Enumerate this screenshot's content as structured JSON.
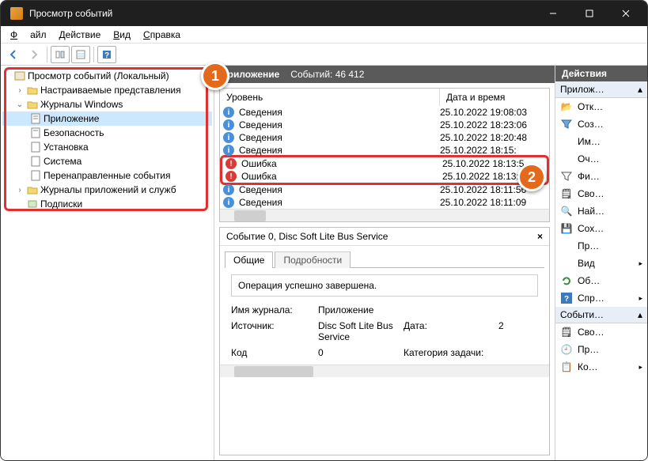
{
  "window": {
    "title": "Просмотр событий"
  },
  "menu": {
    "file": "Файл",
    "action": "Действие",
    "view": "Вид",
    "help": "Справка"
  },
  "tree": {
    "root": "Просмотр событий (Локальный)",
    "custom_views": "Настраиваемые представления",
    "win_logs": "Журналы Windows",
    "app": "Приложение",
    "security": "Безопасность",
    "setup": "Установка",
    "system": "Система",
    "forwarded": "Перенаправленные события",
    "apps_services": "Журналы приложений и служб",
    "subscriptions": "Подписки"
  },
  "center": {
    "name": "Приложение",
    "count_label": "Событий: 46 412",
    "col_level": "Уровень",
    "col_date": "Дата и время",
    "rows": [
      {
        "type": "info",
        "level": "Сведения",
        "date": "25.10.2022 19:08:03"
      },
      {
        "type": "info",
        "level": "Сведения",
        "date": "25.10.2022 18:23:06"
      },
      {
        "type": "info",
        "level": "Сведения",
        "date": "25.10.2022 18:20:48"
      },
      {
        "type": "info",
        "level": "Сведения",
        "date": "25.10.2022 18:15:"
      },
      {
        "type": "error",
        "level": "Ошибка",
        "date": "25.10.2022 18:13:5"
      },
      {
        "type": "error",
        "level": "Ошибка",
        "date": "25.10.2022 18:13:49"
      },
      {
        "type": "info",
        "level": "Сведения",
        "date": "25.10.2022 18:11:56"
      },
      {
        "type": "info",
        "level": "Сведения",
        "date": "25.10.2022 18:11:09"
      }
    ]
  },
  "detail": {
    "title": "Событие 0, Disc Soft Lite Bus Service",
    "tab_general": "Общие",
    "tab_details": "Подробности",
    "message": "Операция успешно завершена.",
    "log_label": "Имя журнала:",
    "log_value": "Приложение",
    "source_label": "Источник:",
    "source_value": "Disc Soft Lite Bus Service",
    "date_label": "Дата:",
    "date_value": "2",
    "code_label": "Код",
    "code_value": "0",
    "cat_label": "Категория задачи:"
  },
  "actions": {
    "title": "Действия",
    "group1": "Прилож…",
    "open": "Отк…",
    "create": "Соз…",
    "import": "Им…",
    "clear": "Оч…",
    "filter": "Фи…",
    "props": "Сво…",
    "find": "Най…",
    "save": "Сох…",
    "attach": "Пр…",
    "view": "Вид",
    "refresh": "Об…",
    "help": "Спр…",
    "group2": "Событи…",
    "evprops": "Сво…",
    "evattach": "Пр…",
    "evcopy": "Ко…"
  }
}
